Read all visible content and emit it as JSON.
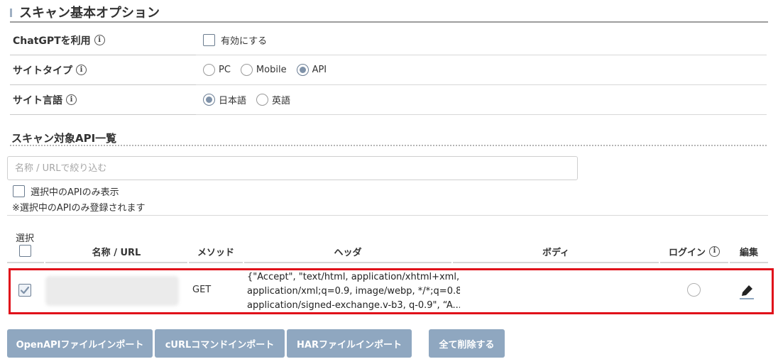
{
  "section": {
    "title": "スキャン基本オプション"
  },
  "options": {
    "chatgpt": {
      "label": "ChatGPTを利用",
      "checkbox_label": "有効にする"
    },
    "site_type": {
      "label": "サイトタイプ",
      "choices": [
        "PC",
        "Mobile",
        "API"
      ],
      "selected": "API"
    },
    "site_lang": {
      "label": "サイト言語",
      "choices": [
        "日本語",
        "英語"
      ],
      "selected": "日本語"
    }
  },
  "api_list": {
    "title": "スキャン対象API一覧",
    "search_placeholder": "名称 / URLで絞り込む",
    "only_selected_label": "選択中のAPIのみ表示",
    "note": "※選択中のAPIのみ登録されます",
    "columns": {
      "select": "選択",
      "name": "名称 / URL",
      "method": "メソッド",
      "header": "ヘッダ",
      "body": "ボディ",
      "login": "ログイン",
      "edit": "編集"
    },
    "rows": [
      {
        "selected": true,
        "method": "GET",
        "header_lines": [
          "{\"Accept\", \"text/html, application/xhtml+xml,",
          "application/xml;q=0.9, image/webp, */*;q=0.8",
          "application/signed-exchange.v-b3, q-0.9\", “A..."
        ],
        "body": "",
        "login": false
      }
    ]
  },
  "buttons": {
    "openapi": "OpenAPIファイルインポート",
    "curl": "cURLコマンドインポート",
    "har": "HARファイルインポート",
    "delete_all": "全て削除する"
  },
  "icons": {
    "info": "info-icon",
    "edit": "pencil-icon",
    "check": "check-icon"
  },
  "colors": {
    "accent": "#8fa7c0",
    "highlight": "#e0101a",
    "radio_on": "#7f92a9"
  }
}
